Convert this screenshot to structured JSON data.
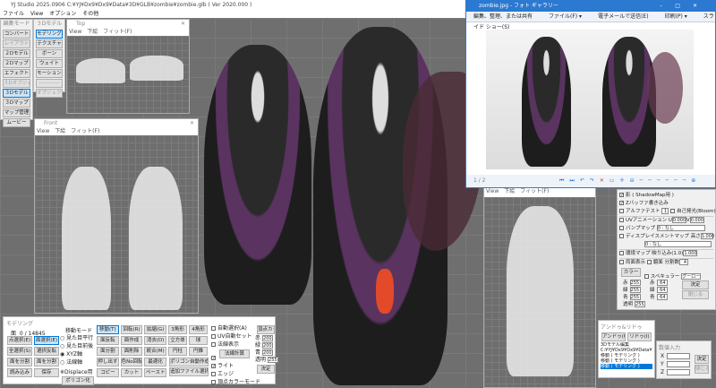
{
  "app": {
    "title": "YJ Studio 2025.0906   C:¥YJ¥Dx9¥Dx9¥Data¥3D¥GLB¥zombie¥zombie.glb ( Ver 2020.000 )",
    "menu": [
      "ファイル",
      "View",
      "オプション",
      "その他"
    ]
  },
  "edit_mode": {
    "header": "編集モード",
    "items": [
      {
        "label": "コンバート"
      },
      {
        "label": "レイアウト",
        "disabled": true
      },
      {
        "label": "２Dモデル"
      },
      {
        "label": "２Dマップ"
      },
      {
        "label": "エフェクト"
      },
      {
        "label": "３Dオブジェクト",
        "disabled": true
      },
      {
        "label": "３Dモデル",
        "selected": true
      },
      {
        "label": "３Dマップ"
      },
      {
        "label": "マップ管理"
      },
      {
        "label": "ムービー"
      }
    ]
  },
  "model_mode": {
    "header": "３Dモデル",
    "items": [
      {
        "label": "モデリング",
        "selected": true
      },
      {
        "label": "テクスチャ"
      },
      {
        "label": "ボーン"
      },
      {
        "label": "ウェイト"
      },
      {
        "label": "モーション"
      },
      {
        "label": "------------",
        "disabled": true
      },
      {
        "label": "オブジェクト",
        "disabled": true
      }
    ]
  },
  "top_view": {
    "title": "Top",
    "menu": [
      "View",
      "下絵",
      "フィット(F)"
    ]
  },
  "front_view": {
    "title": "Front",
    "menu": [
      "View",
      "下絵",
      "フィット(F)"
    ]
  },
  "side_view": {
    "menu": [
      "View",
      "下絵",
      "フィット(F)"
    ]
  },
  "modeling": {
    "title": "モデリング",
    "face_label": "面",
    "face_count": "0 / 14845",
    "left_buttons": [
      [
        "点選択(E)",
        "面選択(E)"
      ],
      [
        "全選択(S)",
        "選択反転"
      ],
      [
        "面を分割",
        "面を分割"
      ],
      [
        "読み込み",
        "保存"
      ]
    ],
    "move_mode": {
      "label": "移動モード",
      "options": [
        "見た目平行",
        "見た目前後",
        "XYZ軸",
        "法線軸"
      ],
      "selected": 2,
      "displace": "※Displace用",
      "polygon_btn": "ポリゴン化"
    },
    "tool_buttons": [
      [
        "移動(T)",
        "回転(R)",
        "拡縮(G)"
      ],
      [
        "面反転",
        "面作成",
        "消去(D)"
      ],
      [
        "面分割",
        "面削除",
        "統合(M)"
      ],
      [
        "押し出す",
        "色No回転",
        "最適化"
      ],
      [
        "コピー",
        "カット",
        "ペースト"
      ]
    ],
    "shape_buttons": [
      [
        "3角形",
        "4角形"
      ],
      [
        "立方体",
        "球"
      ],
      [
        "円柱",
        "円錐"
      ]
    ],
    "poly_auto": "ポリゴン自動作成",
    "add_file": "追加ファイル選択",
    "checks": [
      {
        "label": "自動選択(A)",
        "checked": false
      },
      {
        "label": "UV自動セット",
        "checked": false
      },
      {
        "label": "法線表示",
        "checked": false
      },
      {
        "label": "法線計算",
        "checked": true,
        "button": true
      },
      {
        "label": "ライト",
        "checked": true
      },
      {
        "label": "エッジ",
        "checked": false
      },
      {
        "label": "頂点カラーモード",
        "checked": false
      }
    ],
    "vertex_color_btn": "頂点カラー",
    "rgba": [
      {
        "label": "赤",
        "value": "200"
      },
      {
        "label": "緑",
        "value": "200"
      },
      {
        "label": "青",
        "value": "200"
      },
      {
        "label": "透明",
        "value": "255"
      }
    ],
    "ok": "決定"
  },
  "photo_viewer": {
    "title": "zombie.jpg - フォト ギャラリー",
    "toolbar": [
      "編集、整理、または共有",
      "ファイル(F) ▾",
      "電子メールで送信(E)",
      "印刷(P) ▾",
      "スライド ショー(S)"
    ],
    "page": "1 / 2",
    "accent": "#2b79d0"
  },
  "material": {
    "checks": [
      {
        "label": "影 ( ShadowMap用 )",
        "checked": true
      },
      {
        "label": "Zバッファ書き込み",
        "checked": true
      }
    ],
    "alpha_test": "アルファテスト",
    "alpha_value": "1",
    "self_light": "自己発光(Bloom)",
    "uv_anim": "UVアニメーション",
    "u_label": "U",
    "u": "0.000",
    "v_label": "V",
    "v": "0.000",
    "bump": "バンプマップ",
    "bump_value": "0 : なし",
    "displace": "ディスプレイスメントマップ",
    "height_label": "高さ",
    "height": "1.000",
    "displace_value": "0 : なし",
    "env": "環境マップ",
    "reflect_label": "映り込み(1.0)",
    "reflect": "1.000",
    "double": "両面表示",
    "mirror": "鏡面",
    "divide_label": "分割数",
    "divide": "4",
    "color_btn": "カラー",
    "specular": "スペキュラー",
    "shading": "グーロー",
    "diffuse": [
      {
        "label": "赤",
        "value": "255"
      },
      {
        "label": "緑",
        "value": "255"
      },
      {
        "label": "青",
        "value": "255"
      },
      {
        "label": "透明",
        "value": "255"
      }
    ],
    "spec": [
      {
        "label": "赤",
        "value": "64"
      },
      {
        "label": "緑",
        "value": "64"
      },
      {
        "label": "青",
        "value": "64"
      }
    ],
    "ok": "決定",
    "close": "閉じる"
  },
  "undo": {
    "title": "アンドゥ&リドゥ",
    "undo_btn": "アンドゥ(U)",
    "redo_btn": "リドゥ(I)",
    "history": [
      "3Dモデル編集",
      "C:¥YJ¥Dx9¥Dx9¥Data¥3D",
      "移動 ( モデリング )",
      "移動 ( モデリング )",
      "移動 ( モデリング )"
    ],
    "selected": 4
  },
  "numeric": {
    "title": "数値入力",
    "labels": [
      "X",
      "Y",
      "Z"
    ],
    "ok": "決定",
    "close": "閉じる"
  }
}
